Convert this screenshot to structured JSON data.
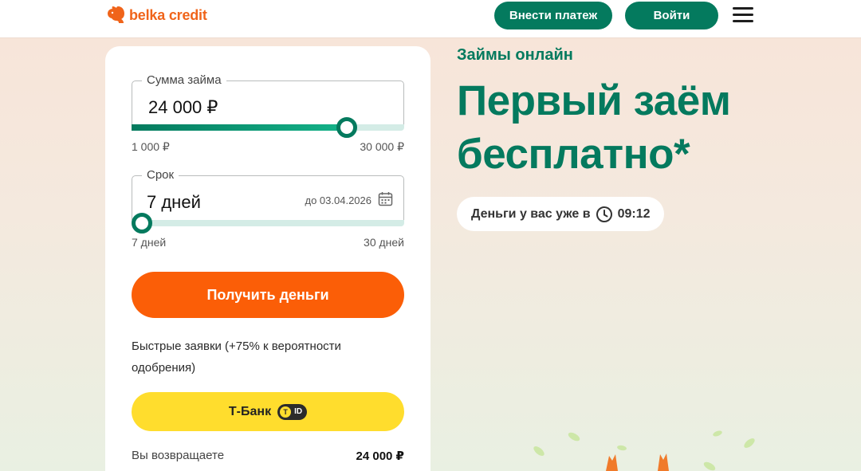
{
  "header": {
    "logo_text": "belka credit",
    "pay_button": "Внести платеж",
    "login_button": "Войти"
  },
  "calculator": {
    "amount": {
      "legend": "Сумма займа",
      "value": "24 000 ₽",
      "min_label": "1 000 ₽",
      "max_label": "30 000 ₽",
      "slider_fraction": 0.79
    },
    "term": {
      "legend": "Срок",
      "value": "7 дней",
      "due_date": "до 03.04.2026",
      "min_label": "7 дней",
      "max_label": "30 дней",
      "slider_fraction": 0.0
    },
    "cta_button": "Получить деньги",
    "fast_apply_text": "Быстрые заявки (+75% к вероятности одобрения)",
    "tbank_button": "Т-Банк",
    "tbank_badge": "ID",
    "return_label": "Вы возвращаете",
    "return_value": "24 000 ₽"
  },
  "hero": {
    "subtitle": "Займы онлайн",
    "headline": "Первый заём бесплатно*",
    "timer_text": "Деньги у вас уже в",
    "timer_value": "09:12"
  },
  "colors": {
    "brand_green": "#047a5e",
    "brand_orange": "#fb5e07",
    "tbank_yellow": "#ffdd2d"
  }
}
